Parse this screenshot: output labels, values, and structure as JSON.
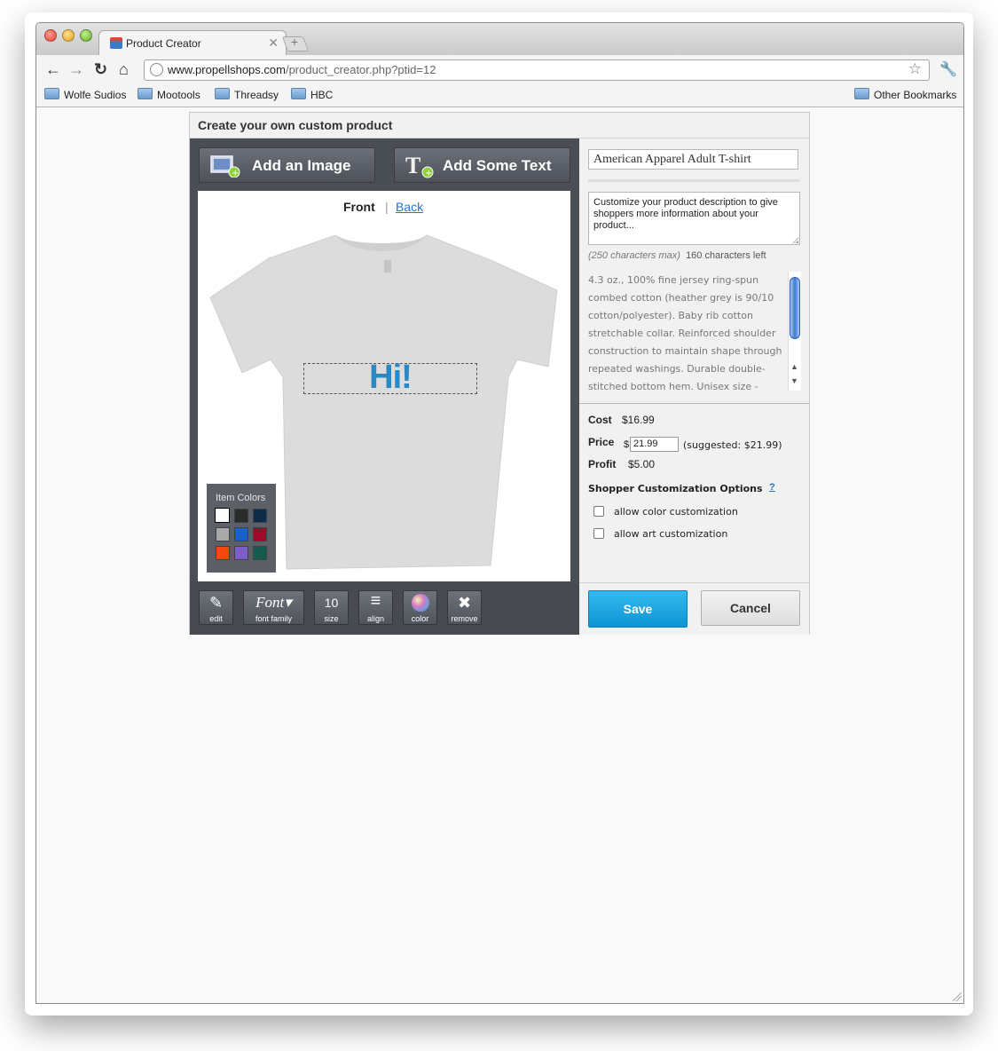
{
  "browser": {
    "tab_title": "Product Creator",
    "url_host": "www.propellshops.com",
    "url_path": "/product_creator.php?ptid=12",
    "bookmarks": [
      "Wolfe Sudios",
      "Mootools",
      "Threadsy",
      "HBC"
    ],
    "other_bookmarks": "Other Bookmarks"
  },
  "creator": {
    "title": "Create your own custom product",
    "add_image_label": "Add an Image",
    "add_text_label": "Add Some Text",
    "view_front": "Front",
    "view_back": "Back",
    "design_text": "Hi!",
    "item_colors_title": "Item Colors",
    "item_colors": [
      "#ffffff",
      "#2b2b2b",
      "#0e2c4a",
      "#a9a9a9",
      "#1560c9",
      "#9e0b2a",
      "#f24a0c",
      "#7c5fc9",
      "#145a4d"
    ],
    "selected_color_index": 0,
    "tools": [
      {
        "label": "edit",
        "glyph": "✎"
      },
      {
        "label": "font family",
        "glyph": "Font"
      },
      {
        "label": "size",
        "glyph": "10"
      },
      {
        "label": "align",
        "glyph": "≡"
      },
      {
        "label": "color",
        "glyph": "●"
      },
      {
        "label": "remove",
        "glyph": "✖"
      }
    ]
  },
  "details": {
    "product_name": "American Apparel Adult T-shirt",
    "description_placeholder": "Customize your product description to give shoppers more information about your product...",
    "char_max": "(250 characters max)",
    "chars_left": "160 characters left",
    "specs": "4.3 oz., 100% fine jersey ring-spun combed cotton (heather grey is 90/10 cotton/polyester). Baby rib cotton stretchable collar. Reinforced shoulder construction to maintain shape through repeated washings. Durable double-stitched bottom hem. Unisex size -",
    "cost_label": "Cost",
    "cost_value": "$16.99",
    "price_label": "Price",
    "price_currency": "$",
    "price_value": "21.99",
    "suggested": "(suggested: $21.99)",
    "profit_label": "Profit",
    "profit_value": "$5.00",
    "options_title": "Shopper Customization Options",
    "help_link": "?",
    "option_color": "allow color customization",
    "option_art": "allow art customization",
    "save_label": "Save",
    "cancel_label": "Cancel"
  }
}
